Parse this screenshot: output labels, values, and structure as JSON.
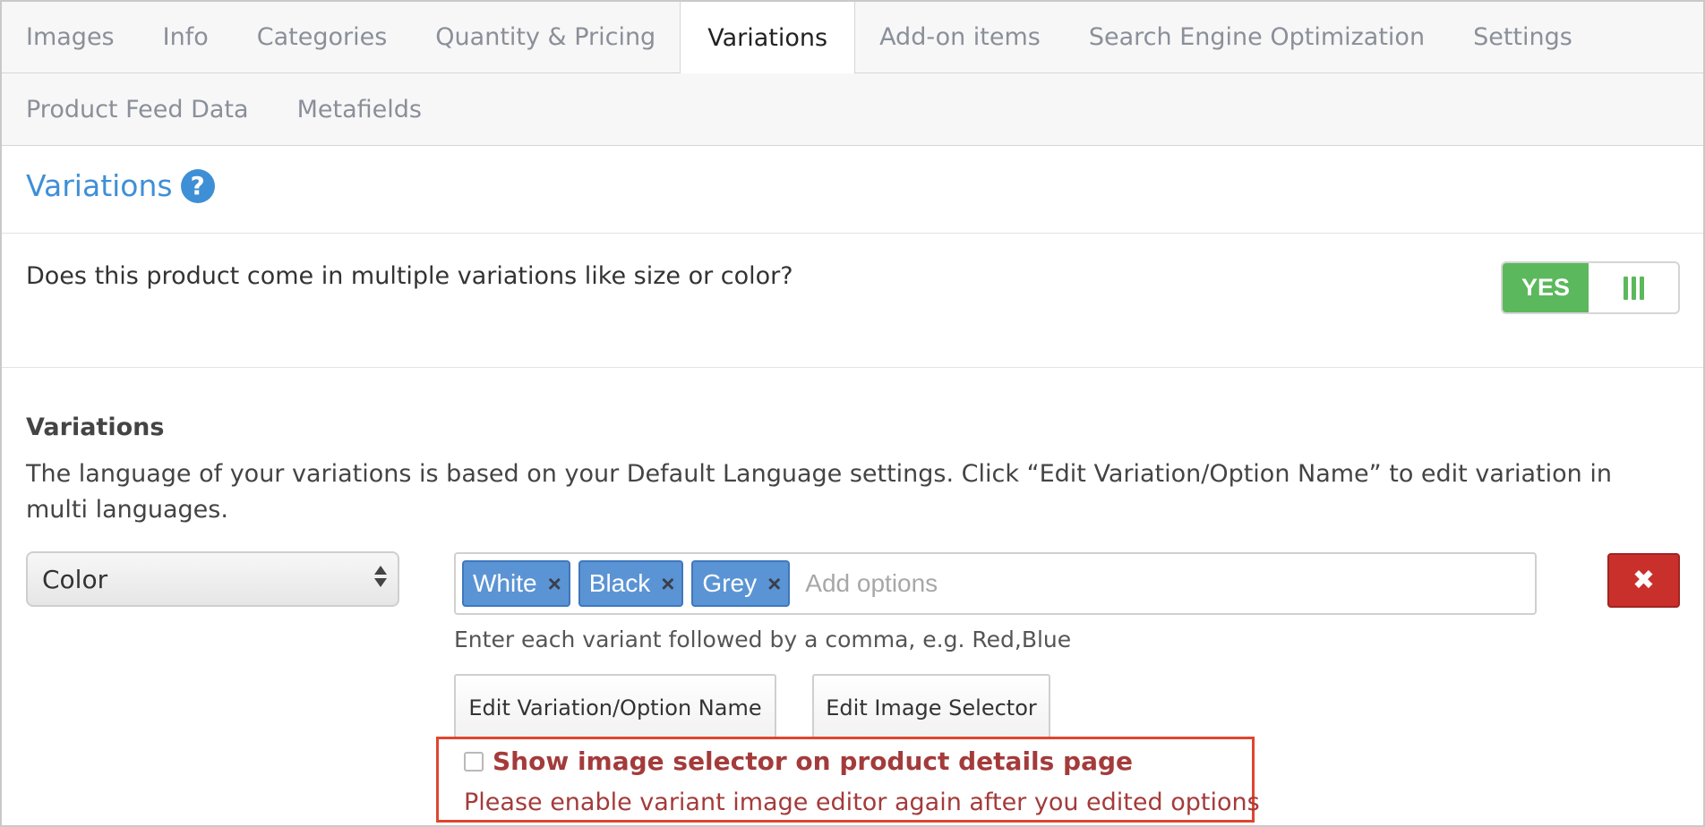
{
  "tabs": {
    "row1": [
      {
        "label": "Images",
        "active": false
      },
      {
        "label": "Info",
        "active": false
      },
      {
        "label": "Categories",
        "active": false
      },
      {
        "label": "Quantity & Pricing",
        "active": false
      },
      {
        "label": "Variations",
        "active": true
      },
      {
        "label": "Add-on items",
        "active": false
      },
      {
        "label": "Search Engine Optimization",
        "active": false
      },
      {
        "label": "Settings",
        "active": false
      }
    ],
    "row2": [
      {
        "label": "Product Feed Data",
        "active": false
      },
      {
        "label": "Metafields",
        "active": false
      }
    ]
  },
  "section": {
    "title": "Variations",
    "help_glyph": "?"
  },
  "question": {
    "text": "Does this product come in multiple variations like size or color?",
    "toggle_label": "YES",
    "toggle_on": true
  },
  "variations": {
    "heading": "Variations",
    "description": "The language of your variations is based on your Default Language settings. Click “Edit Variation/Option Name” to edit variation in multi languages.",
    "type_select": {
      "value": "Color"
    },
    "options": [
      {
        "label": "White",
        "remove": "×"
      },
      {
        "label": "Black",
        "remove": "×"
      },
      {
        "label": "Grey",
        "remove": "×"
      }
    ],
    "options_placeholder": "Add options",
    "delete_glyph": "✖",
    "hint": "Enter each variant followed by a comma, e.g. Red,Blue",
    "edit_name_button": "Edit Variation/Option Name",
    "edit_image_button": "Edit Image Selector",
    "show_selector_label": "Show image selector on product details page",
    "show_selector_checked": false,
    "warning": "Please enable variant image editor again after you edited options"
  },
  "colors": {
    "accent_blue": "#3f8fd6",
    "toggle_green": "#5cb85c",
    "tag_blue": "#5b94d4",
    "danger_red": "#c9302c",
    "warning_text": "#a43b3b",
    "warning_border": "#e0452f"
  },
  "icons": {
    "help": "help-icon",
    "tag_remove": "close-icon",
    "delete": "delete-icon",
    "toggle_grip": "grip-icon",
    "select_arrows": "sort-arrows-icon"
  }
}
